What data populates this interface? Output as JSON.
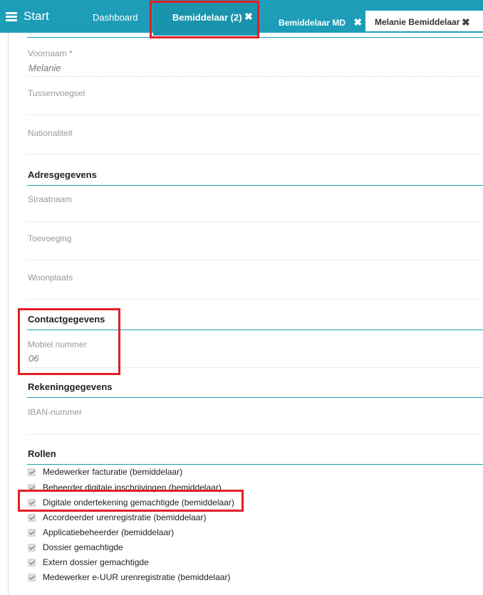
{
  "header": {
    "start_label": "Start",
    "tabs": [
      {
        "label": "Dashboard"
      },
      {
        "label": "Bemiddelaar (2)",
        "close": "✖"
      },
      {
        "label": "Bemiddelaar MD",
        "close": "✖"
      },
      {
        "label": "Melanie Bemiddelaar",
        "close": "✖"
      }
    ],
    "accent_color": "#1d9db7"
  },
  "personal": {
    "voornaam_label": "Voornaam *",
    "voornaam_value": "Melanie",
    "tussenvoegsel_label": "Tussenvoegsel",
    "nationaliteit_label": "Nationaliteit"
  },
  "adres": {
    "heading": "Adresgegevens",
    "straatnaam_label": "Straatnaam",
    "toevoeging_label": "Toevoeging",
    "woonplaats_label": "Woonplaats"
  },
  "contact": {
    "heading": "Contactgegevens",
    "mobiel_label": "Mobiel nummer",
    "mobiel_value": "06"
  },
  "rekening": {
    "heading": "Rekeninggegevens",
    "iban_label": "IBAN-nummer"
  },
  "rollen": {
    "heading": "Rollen",
    "items": [
      "Medewerker facturatie (bemiddelaar)",
      "Beheerder digitale inschrijvingen (bemiddelaar)",
      "Digitale ondertekening gemachtigde (bemiddelaar)",
      "Accordeerder urenregistratie (bemiddelaar)",
      "Applicatiebeheerder (bemiddelaar)",
      "Dossier gemachtigde",
      "Extern dossier gemachtigde",
      "Medewerker e-UUR urenregistratie (bemiddelaar)"
    ]
  }
}
